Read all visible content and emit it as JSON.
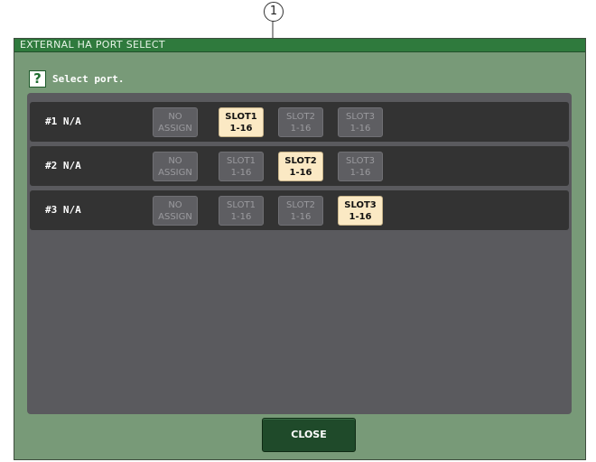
{
  "callout": {
    "number": "1"
  },
  "window": {
    "title": "EXTERNAL HA PORT SELECT",
    "help_icon": "?",
    "instruction": "Select port.",
    "close_label": "CLOSE"
  },
  "rows": [
    {
      "label": "#1 N/A",
      "buttons": [
        {
          "line1": "NO",
          "line2": "ASSIGN",
          "selected": false
        },
        {
          "line1": "SLOT1",
          "line2": "1-16",
          "selected": true
        },
        {
          "line1": "SLOT2",
          "line2": "1-16",
          "selected": false
        },
        {
          "line1": "SLOT3",
          "line2": "1-16",
          "selected": false
        }
      ]
    },
    {
      "label": "#2 N/A",
      "buttons": [
        {
          "line1": "NO",
          "line2": "ASSIGN",
          "selected": false
        },
        {
          "line1": "SLOT1",
          "line2": "1-16",
          "selected": false
        },
        {
          "line1": "SLOT2",
          "line2": "1-16",
          "selected": true
        },
        {
          "line1": "SLOT3",
          "line2": "1-16",
          "selected": false
        }
      ]
    },
    {
      "label": "#3 N/A",
      "buttons": [
        {
          "line1": "NO",
          "line2": "ASSIGN",
          "selected": false
        },
        {
          "line1": "SLOT1",
          "line2": "1-16",
          "selected": false
        },
        {
          "line1": "SLOT2",
          "line2": "1-16",
          "selected": false
        },
        {
          "line1": "SLOT3",
          "line2": "1-16",
          "selected": true
        }
      ]
    }
  ],
  "colors": {
    "window_bg": "#789a78",
    "titlebar": "#2f7a3d",
    "selected_button": "#fbe9c4",
    "unselected_button": "#5e5e62"
  }
}
